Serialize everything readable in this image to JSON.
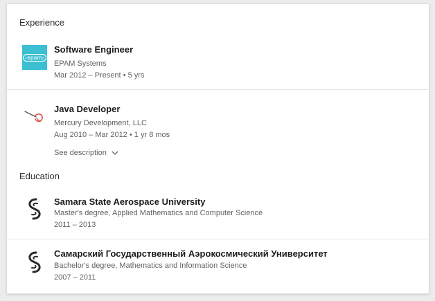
{
  "experience": {
    "heading": "Experience",
    "items": [
      {
        "title": "Software Engineer",
        "company": "EPAM Systems",
        "dates": "Mar 2012 – Present",
        "duration": "5 yrs",
        "logo_text": "‹epam›",
        "logo_icon": "epam-logo"
      },
      {
        "title": "Java Developer",
        "company": "Mercury Development, LLC",
        "dates": "Aug 2010 – Mar 2012",
        "duration": "1 yr 8 mos",
        "see_description": "See description",
        "logo_icon": "mercury-logo"
      }
    ]
  },
  "education": {
    "heading": "Education",
    "items": [
      {
        "school": "Samara State Aerospace University",
        "degree": "Master's degree, Applied Mathematics and Computer Science",
        "years": "2011 – 2013",
        "logo_icon": "ssau-logo"
      },
      {
        "school": "Самарский Государственный Аэрокосмический Университет",
        "degree": "Bachelor's degree, Mathematics and Information Science",
        "years": "2007 – 2011",
        "logo_icon": "ssau-logo"
      }
    ]
  },
  "colors": {
    "epam_brand": "#3cbfd3",
    "mercury_red": "#d84a3a",
    "ssau_dark": "#2a2a2a"
  }
}
